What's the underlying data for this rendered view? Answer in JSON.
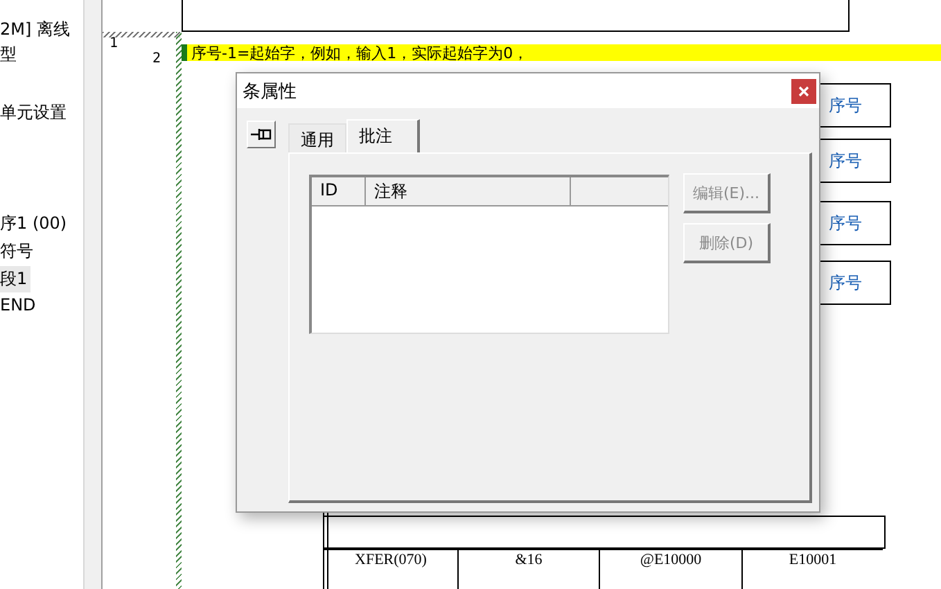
{
  "tree": {
    "items": [
      {
        "label": "2M] 离线",
        "selected": false
      },
      {
        "label": "型",
        "selected": false
      },
      {
        "label": "单元设置",
        "selected": false
      },
      {
        "label": "序1 (00)",
        "selected": false
      },
      {
        "label": "符号",
        "selected": false
      },
      {
        "label": "段1",
        "selected": true
      },
      {
        "label": "END",
        "selected": false
      }
    ]
  },
  "ladder": {
    "line_numbers": [
      "1",
      "2"
    ],
    "comment": "序号-1=起始字，例如，输入1，实际起始字为0，",
    "right_labels": [
      "序号",
      "序号",
      "序号",
      "序号"
    ],
    "instruction": {
      "cells": [
        "XFER(070)",
        "&16",
        "@E10000",
        "E10001"
      ]
    }
  },
  "dialog": {
    "title": "条属性",
    "tabs": [
      {
        "label": "通用",
        "selected": false
      },
      {
        "label": "批注",
        "selected": true
      }
    ],
    "list": {
      "columns": [
        "ID",
        "注释"
      ]
    },
    "buttons": [
      {
        "label": "编辑(E)...",
        "disabled": true
      },
      {
        "label": "删除(D)",
        "disabled": true
      }
    ]
  }
}
